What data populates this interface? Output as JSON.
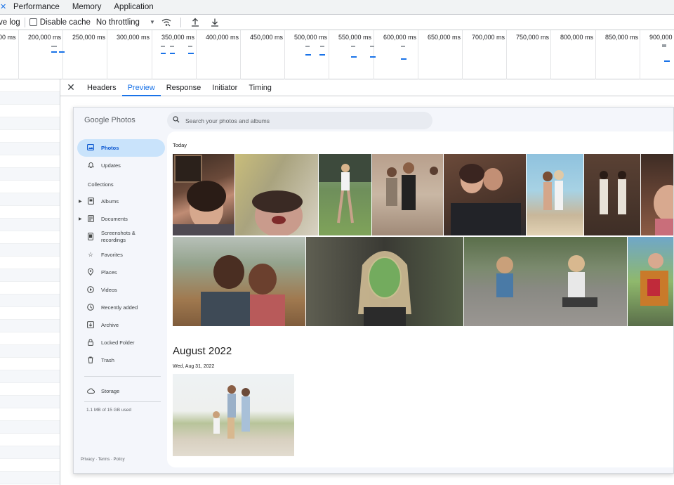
{
  "devtools": {
    "tabs": [
      {
        "label": "Performance"
      },
      {
        "label": "Memory"
      },
      {
        "label": "Application"
      }
    ],
    "toolbar": {
      "preserve_log": "ve log",
      "disable_cache": "Disable cache",
      "throttling": "No throttling"
    },
    "timeline": {
      "labels": [
        "00 ms",
        "200,000 ms",
        "250,000 ms",
        "300,000 ms",
        "350,000 ms",
        "400,000 ms",
        "450,000 ms",
        "500,000 ms",
        "550,000 ms",
        "600,000 ms",
        "650,000 ms",
        "700,000 ms",
        "750,000 ms",
        "800,000 ms",
        "850,000 ms",
        "900,000"
      ]
    },
    "detail_tabs": {
      "headers": "Headers",
      "preview": "Preview",
      "response": "Response",
      "initiator": "Initiator",
      "timing": "Timing"
    }
  },
  "photos": {
    "logo_text": "Google Photos",
    "search_placeholder": "Search your photos and albums",
    "nav": {
      "photos": "Photos",
      "updates": "Updates",
      "collections": "Collections",
      "albums": "Albums",
      "documents": "Documents",
      "screenshots_line1": "Screenshots &",
      "screenshots_line2": "recordings",
      "favorites": "Favorites",
      "places": "Places",
      "videos": "Videos",
      "recently_added": "Recently added",
      "archive": "Archive",
      "locked_folder": "Locked Folder",
      "trash": "Trash",
      "storage": "Storage",
      "storage_used": "1.1 MB of 15 GB used",
      "footer": "Privacy · Terms · Policy"
    },
    "sections": {
      "today": "Today",
      "august_2022": "August 2022",
      "aug_date": "Wed, Aug 31, 2022"
    }
  }
}
